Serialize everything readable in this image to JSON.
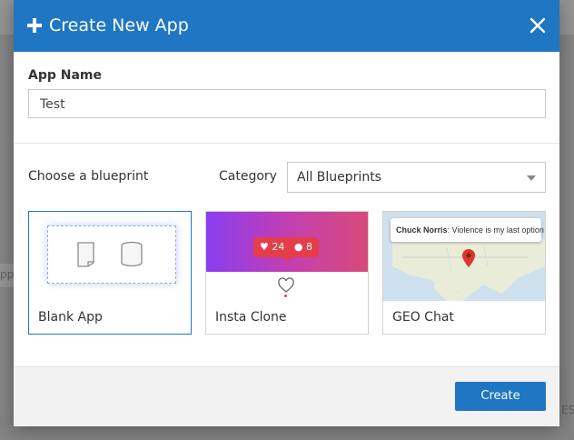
{
  "background": {
    "left_text": "pp",
    "right_text": "ES"
  },
  "modal": {
    "title": "Create New App",
    "app_name_label": "App Name",
    "app_name_value": "Test",
    "choose_label": "Choose a blueprint",
    "category_label": "Category",
    "category_selected": "All Blueprints",
    "create_label": "Create"
  },
  "blueprints": [
    {
      "label": "Blank App",
      "selected": true
    },
    {
      "label": "Insta Clone",
      "selected": false,
      "likes": "24",
      "followers": "8"
    },
    {
      "label": "GEO Chat",
      "selected": false,
      "tooltip_user": "Chuck Norris",
      "tooltip_message": ": Violence is my last option"
    }
  ],
  "colors": {
    "header": "#1f76c2",
    "accent": "#1f76c2",
    "insta_red": "#e63d4b",
    "pin_red": "#d9372e"
  }
}
